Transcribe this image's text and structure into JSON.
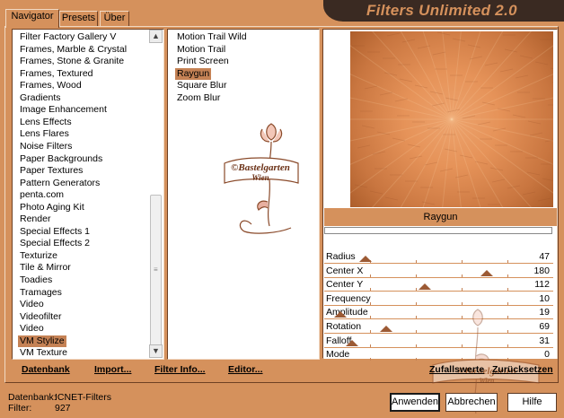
{
  "app": {
    "title": "Filters Unlimited 2.0"
  },
  "tabs": [
    {
      "label": "Navigator",
      "active": true
    },
    {
      "label": "Presets",
      "active": false
    },
    {
      "label": "Über",
      "active": false
    }
  ],
  "categories": {
    "items": [
      "Filter Factory Gallery V",
      "Frames, Marble & Crystal",
      "Frames, Stone & Granite",
      "Frames, Textured",
      "Frames, Wood",
      "Gradients",
      "Image Enhancement",
      "Lens Effects",
      "Lens Flares",
      "Noise Filters",
      "Paper Backgrounds",
      "Paper Textures",
      "Pattern Generators",
      "penta.com",
      "Photo Aging Kit",
      "Render",
      "Special Effects 1",
      "Special Effects 2",
      "Texturize",
      "Tile & Mirror",
      "Toadies",
      "Tramages",
      "Video",
      "Videofilter",
      "Video",
      "VM Stylize",
      "VM Texture"
    ],
    "selected": "VM Stylize"
  },
  "filters": {
    "items": [
      "Motion Trail Wild",
      "Motion Trail",
      "Print Screen",
      "Raygun",
      "Square Blur",
      "Zoom Blur"
    ],
    "selected": "Raygun"
  },
  "preview": {
    "filter_name": "Raygun"
  },
  "parameters": [
    {
      "label": "Radius",
      "value": "47",
      "level": 0.18
    },
    {
      "label": "Center X",
      "value": "180",
      "level": 0.71
    },
    {
      "label": "Center Y",
      "value": "112",
      "level": 0.44
    },
    {
      "label": "Frequency",
      "value": "10",
      "level": null
    },
    {
      "label": "Amplitude",
      "value": "19",
      "level": 0.07
    },
    {
      "label": "Rotation",
      "value": "69",
      "level": 0.27
    },
    {
      "label": "Falloff",
      "value": "31",
      "level": 0.12
    },
    {
      "label": "Mode",
      "value": "0",
      "level": null
    }
  ],
  "links": {
    "datenbank": "Datenbank",
    "import": "Import...",
    "filter_info": "Filter Info...",
    "editor": "Editor...",
    "zufallswerte": "Zufallswerte",
    "zuruecksetzen": "Zurücksetzen"
  },
  "status": {
    "db_label": "Datenbank:",
    "db_value": "ICNET-Filters",
    "filter_label": "Filter:",
    "filter_value": "927"
  },
  "buttons": {
    "apply": "Anwenden",
    "cancel": "Abbrechen",
    "help": "Hilfe"
  },
  "watermark": {
    "line1": "©Bastelgarten",
    "line2": "Wien"
  },
  "colors": {
    "background": "#d5915c",
    "banner": "#3a2a22",
    "selection": "#c58255",
    "thumb": "#9c5a34"
  }
}
